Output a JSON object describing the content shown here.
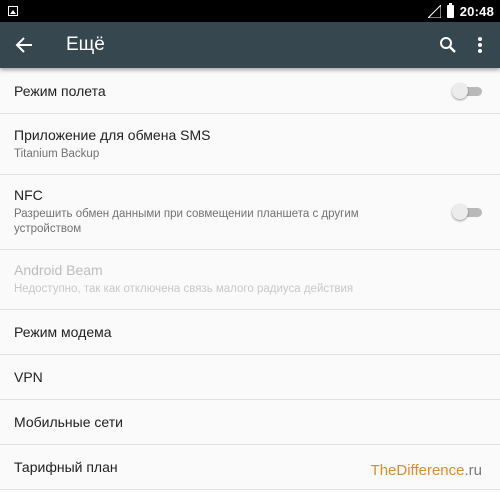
{
  "status_bar": {
    "time": "20:48"
  },
  "app_bar": {
    "title": "Ещё"
  },
  "items": [
    {
      "title": "Режим полета",
      "toggle": "off"
    },
    {
      "title": "Приложение для обмена SMS",
      "subtitle": "Titanium Backup"
    },
    {
      "title": "NFC",
      "subtitle": "Разрешить обмен данными при совмещении планшета с другим устройством",
      "toggle": "off"
    },
    {
      "title": "Android Beam",
      "subtitle": "Недоступно, так как отключена связь малого радиуса действия",
      "enabled": false
    },
    {
      "title": "Режим модема"
    },
    {
      "title": "VPN"
    },
    {
      "title": "Мобильные сети"
    },
    {
      "title": "Тарифный план"
    }
  ],
  "watermark": {
    "part1": "TheDifference",
    "part2": ".ru"
  },
  "colors": {
    "app_bar": "#37474f",
    "status_bar": "#000000",
    "background": "#fafafa",
    "divider": "#e0e0e0"
  }
}
